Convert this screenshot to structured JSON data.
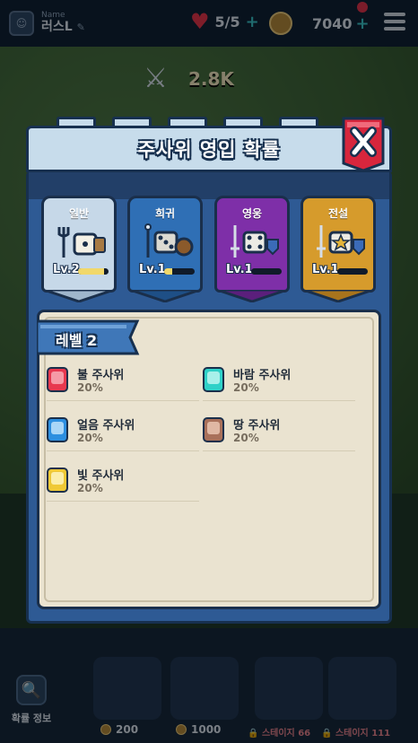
{
  "topbar": {
    "name_caption": "Name",
    "player_name": "러스L",
    "hearts": "5/5",
    "coins": "7040"
  },
  "scene": {
    "dps": "2.8K"
  },
  "modal": {
    "title": "주사위 영입 확률",
    "tiers": [
      {
        "name": "일반",
        "level": "Lv.2",
        "progress": 0.85,
        "color": "#c6d8e8",
        "tip": "#9fb6cc"
      },
      {
        "name": "희귀",
        "level": "Lv.1",
        "progress": 0.25,
        "color": "#2f6fb5",
        "tip": "#1e4f86"
      },
      {
        "name": "영웅",
        "level": "Lv.1",
        "progress": 0,
        "color": "#7e2fa8",
        "tip": "#5b1f7c"
      },
      {
        "name": "전설",
        "level": "Lv.1",
        "progress": 0,
        "color": "#d69b2c",
        "tip": "#a8741c"
      }
    ],
    "level_label": "레벨 2",
    "entries": [
      {
        "name": "불 주사위",
        "pct": "20%",
        "color": "#e8384f",
        "inner": "#f59aa6"
      },
      {
        "name": "바람 주사위",
        "pct": "20%",
        "color": "#2fd1c8",
        "inner": "#a8f0ea"
      },
      {
        "name": "얼음 주사위",
        "pct": "20%",
        "color": "#2d8fe0",
        "inner": "#a9d6f7"
      },
      {
        "name": "땅 주사위",
        "pct": "20%",
        "color": "#a9705a",
        "inner": "#e0b8a4"
      },
      {
        "name": "빛 주사위",
        "pct": "20%",
        "color": "#f0c936",
        "inner": "#fbeeaa"
      }
    ]
  },
  "bottom": {
    "prob_label": "확률 정보",
    "price_1": "200",
    "price_2": "1000",
    "lock_1": "스테이지 66",
    "lock_2": "스테이지 111"
  }
}
